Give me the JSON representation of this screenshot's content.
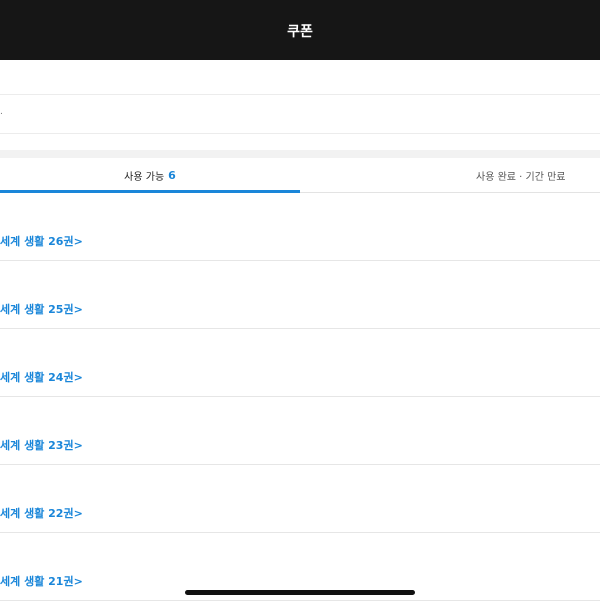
{
  "header": {
    "title": "쿠폰"
  },
  "info_row": {
    "text": "."
  },
  "tabs": [
    {
      "label": "사용 가능",
      "count": "6"
    },
    {
      "label": "사용 완료 · 기간 만료"
    }
  ],
  "coupons": [
    {
      "title": "세계 생활 26권>"
    },
    {
      "title": "세계 생활 25권>"
    },
    {
      "title": "세계 생활 24권>"
    },
    {
      "title": "세계 생활 23권>"
    },
    {
      "title": "세계 생활 22권>"
    },
    {
      "title": "세계 생활 21권>"
    }
  ],
  "colors": {
    "accent": "#1a86d9",
    "header_bg": "#161616"
  }
}
